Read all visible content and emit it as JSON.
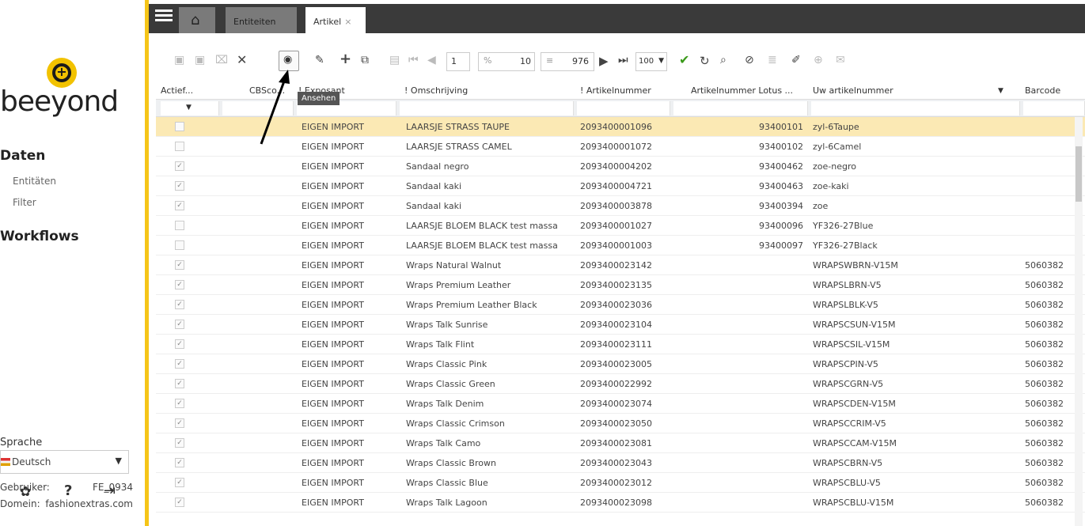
{
  "sidebar": {
    "logo_text": "beeyond",
    "daten_heading": "Daten",
    "links": [
      "Entitäten",
      "Filter"
    ],
    "workflows_heading": "Workflows",
    "sprache_label": "Sprache",
    "language": "Deutsch",
    "gebruiker_label": "Gebruiker:",
    "gebruiker_value": "FE_0934",
    "domein_label": "Domein:",
    "domein_value": "fashionextras.com",
    "footer_icons": [
      "gear-icon",
      "help-icon",
      "logout-icon"
    ]
  },
  "tabs": [
    {
      "label": "",
      "icon": "home-icon"
    },
    {
      "label": "Entiteiten"
    },
    {
      "label": "Artikel"
    }
  ],
  "toolbar": {
    "page": "1",
    "per_page": "10",
    "total": "976",
    "page_size": "100",
    "tooltip": "Ansehen"
  },
  "columns": [
    "Actief...",
    "CBSco...",
    "! Exposant",
    "! Omschrijving",
    "! Artikelnummer",
    "Artikelnummer Lotus ...",
    "Uw artikelnummer",
    "Barcode"
  ],
  "rows": [
    {
      "actief": false,
      "exp": "EIGEN IMPORT",
      "oms": "LAARSJE STRASS TAUPE",
      "art": "2093400001096",
      "lotus": "93400101",
      "uw": "zyl-6Taupe",
      "bar": "",
      "sel": true
    },
    {
      "actief": false,
      "exp": "EIGEN IMPORT",
      "oms": "LAARSJE STRASS CAMEL",
      "art": "2093400001072",
      "lotus": "93400102",
      "uw": "zyl-6Camel",
      "bar": ""
    },
    {
      "actief": true,
      "exp": "EIGEN IMPORT",
      "oms": "Sandaal negro",
      "art": "2093400004202",
      "lotus": "93400462",
      "uw": "zoe-negro",
      "bar": ""
    },
    {
      "actief": true,
      "exp": "EIGEN IMPORT",
      "oms": "Sandaal kaki",
      "art": "2093400004721",
      "lotus": "93400463",
      "uw": "zoe-kaki",
      "bar": ""
    },
    {
      "actief": true,
      "exp": "EIGEN IMPORT",
      "oms": "Sandaal kaki",
      "art": "2093400003878",
      "lotus": "93400394",
      "uw": "zoe",
      "bar": ""
    },
    {
      "actief": false,
      "exp": "EIGEN IMPORT",
      "oms": "LAARSJE BLOEM BLACK test massa",
      "art": "2093400001027",
      "lotus": "93400096",
      "uw": "YF326-27Blue",
      "bar": ""
    },
    {
      "actief": false,
      "exp": "EIGEN IMPORT",
      "oms": "LAARSJE BLOEM BLACK test massa",
      "art": "2093400001003",
      "lotus": "93400097",
      "uw": "YF326-27Black",
      "bar": ""
    },
    {
      "actief": true,
      "exp": "EIGEN IMPORT",
      "oms": "Wraps Natural Walnut",
      "art": "2093400023142",
      "lotus": "",
      "uw": "WRAPSWBRN-V15M",
      "bar": "5060382"
    },
    {
      "actief": true,
      "exp": "EIGEN IMPORT",
      "oms": "Wraps Premium Leather",
      "art": "2093400023135",
      "lotus": "",
      "uw": "WRAPSLBRN-V5",
      "bar": "5060382"
    },
    {
      "actief": true,
      "exp": "EIGEN IMPORT",
      "oms": "Wraps Premium Leather Black",
      "art": "2093400023036",
      "lotus": "",
      "uw": "WRAPSLBLK-V5",
      "bar": "5060382"
    },
    {
      "actief": true,
      "exp": "EIGEN IMPORT",
      "oms": "Wraps Talk Sunrise",
      "art": "2093400023104",
      "lotus": "",
      "uw": "WRAPSCSUN-V15M",
      "bar": "5060382"
    },
    {
      "actief": true,
      "exp": "EIGEN IMPORT",
      "oms": "Wraps Talk Flint",
      "art": "2093400023111",
      "lotus": "",
      "uw": "WRAPSCSIL-V15M",
      "bar": "5060382"
    },
    {
      "actief": true,
      "exp": "EIGEN IMPORT",
      "oms": "Wraps Classic Pink",
      "art": "2093400023005",
      "lotus": "",
      "uw": "WRAPSCPIN-V5",
      "bar": "5060382"
    },
    {
      "actief": true,
      "exp": "EIGEN IMPORT",
      "oms": "Wraps Classic Green",
      "art": "2093400022992",
      "lotus": "",
      "uw": "WRAPSCGRN-V5",
      "bar": "5060382"
    },
    {
      "actief": true,
      "exp": "EIGEN IMPORT",
      "oms": "Wraps Talk Denim",
      "art": "2093400023074",
      "lotus": "",
      "uw": "WRAPSCDEN-V15M",
      "bar": "5060382"
    },
    {
      "actief": true,
      "exp": "EIGEN IMPORT",
      "oms": "Wraps Classic Crimson",
      "art": "2093400023050",
      "lotus": "",
      "uw": "WRAPSCCRIM-V5",
      "bar": "5060382"
    },
    {
      "actief": true,
      "exp": "EIGEN IMPORT",
      "oms": "Wraps Talk Camo",
      "art": "2093400023081",
      "lotus": "",
      "uw": "WRAPSCCAM-V15M",
      "bar": "5060382"
    },
    {
      "actief": true,
      "exp": "EIGEN IMPORT",
      "oms": "Wraps Classic Brown",
      "art": "2093400023043",
      "lotus": "",
      "uw": "WRAPSCBRN-V5",
      "bar": "5060382"
    },
    {
      "actief": true,
      "exp": "EIGEN IMPORT",
      "oms": "Wraps Classic Blue",
      "art": "2093400023012",
      "lotus": "",
      "uw": "WRAPSCBLU-V5",
      "bar": "5060382"
    },
    {
      "actief": true,
      "exp": "EIGEN IMPORT",
      "oms": "Wraps Talk Lagoon",
      "art": "2093400023098",
      "lotus": "",
      "uw": "WRAPSCBLU-V15M",
      "bar": "5060382"
    }
  ],
  "colors": {
    "accent": "#f5c518",
    "topbar": "#3a3a3a",
    "selected_row": "#fbe9b4",
    "save_check": "#3a9a1a"
  }
}
